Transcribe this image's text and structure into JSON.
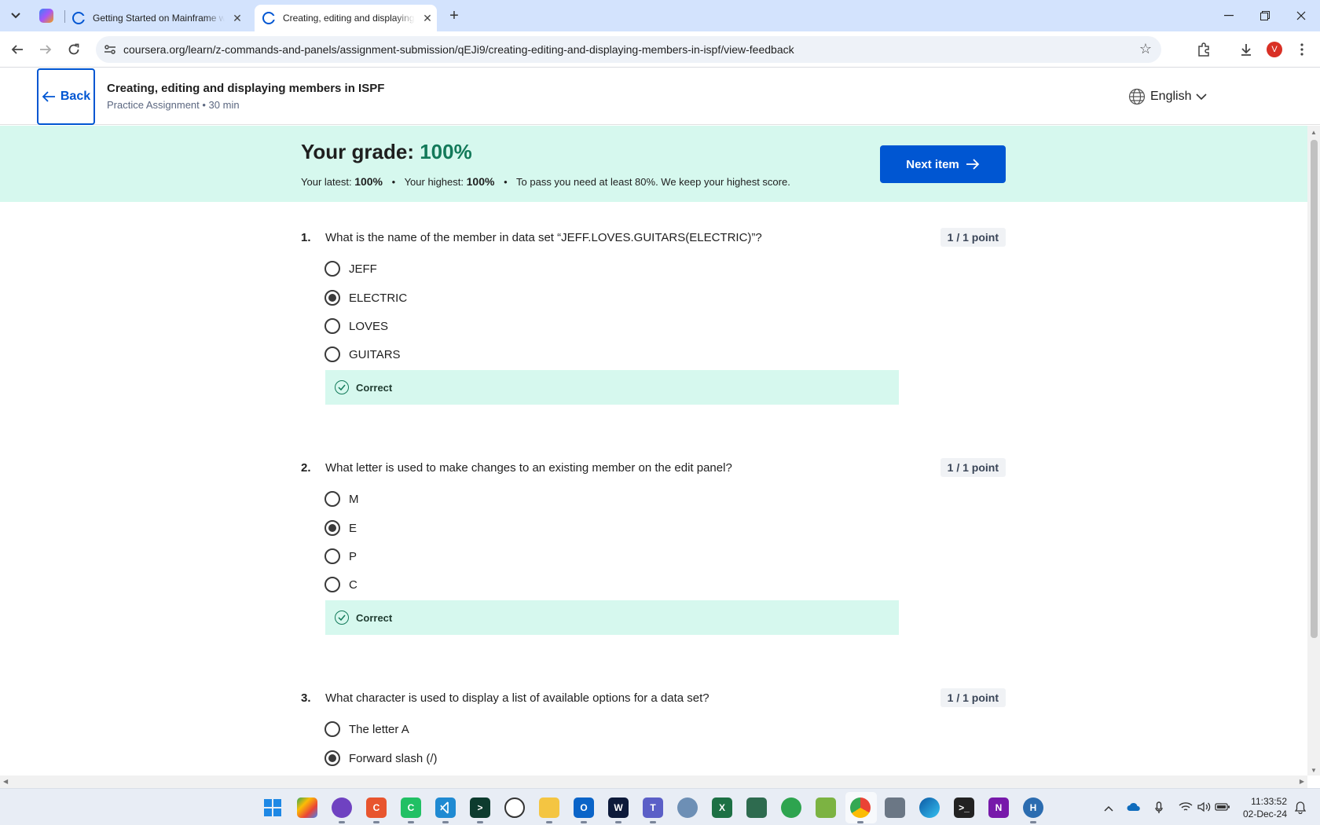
{
  "browser": {
    "tabs": [
      {
        "label": "Getting Started on Mainframe w",
        "active": false
      },
      {
        "label": "Creating, editing and displaying",
        "active": true
      }
    ],
    "url": "coursera.org/learn/z-commands-and-panels/assignment-submission/qEJi9/creating-editing-and-displaying-members-in-ispf/view-feedback",
    "profile_initial": "V"
  },
  "header": {
    "back_label": "Back",
    "title": "Creating, editing and displaying members in ISPF",
    "subtitle": "Practice Assignment • 30 min",
    "language": "English"
  },
  "grade": {
    "title_prefix": "Your grade: ",
    "percent": "100%",
    "latest_label": "Your latest:",
    "latest_value": "100%",
    "highest_label": "Your highest:",
    "highest_value": "100%",
    "pass_note": "To pass you need at least 80%. We keep your highest score.",
    "next_button": "Next item"
  },
  "questions": [
    {
      "number": "1.",
      "text": "What is the name of the member in data set “JEFF.LOVES.GUITARS(ELECTRIC)”?",
      "points": "1 / 1 point",
      "options": [
        "JEFF",
        "ELECTRIC",
        "LOVES",
        "GUITARS"
      ],
      "selected": 1,
      "feedback": "Correct"
    },
    {
      "number": "2.",
      "text": "What letter is used to make changes to an existing member on the edit panel?",
      "points": "1 / 1 point",
      "options": [
        "M",
        "E",
        "P",
        "C"
      ],
      "selected": 1,
      "feedback": "Correct"
    },
    {
      "number": "3.",
      "text": "What character is used to display a list of available options for a data set?",
      "points": "1 / 1 point",
      "options": [
        "The letter A",
        "Forward slash (/)"
      ],
      "selected": 1
    }
  ],
  "taskbar": {
    "time": "11:33:52",
    "date": "02-Dec-24"
  },
  "colors": {
    "accent": "#0056d2",
    "success_bg": "#d6f8ee",
    "success_text": "#137a5a"
  }
}
